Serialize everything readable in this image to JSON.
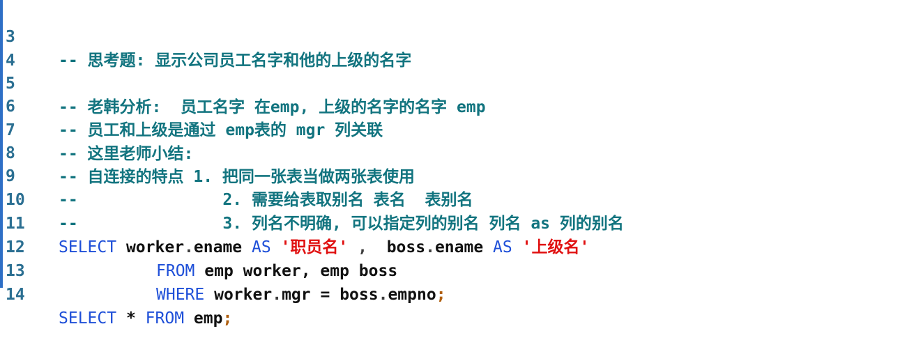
{
  "editor": {
    "lines": [
      {
        "n": "3",
        "text": "-- 思考题: 显示公司员工名字和他的上级的名字"
      },
      {
        "n": "4",
        "text": ""
      },
      {
        "n": "5",
        "text": "-- 老韩分析:  员工名字 在emp, 上级的名字的名字 emp"
      },
      {
        "n": "6",
        "text": "-- 员工和上级是通过 emp表的 mgr 列关联"
      },
      {
        "n": "7",
        "text": "-- 这里老师小结:"
      },
      {
        "n": "8",
        "text": "-- 自连接的特点 1. 把同一张表当做两张表使用"
      },
      {
        "n": "9",
        "text": "--               2. 需要给表取别名 表名  表别名"
      },
      {
        "n": "10",
        "text": "--               3. 列名不明确, 可以指定列的别名 列名 as 列的别名"
      },
      {
        "n": "11"
      },
      {
        "n": "12"
      },
      {
        "n": "13"
      },
      {
        "n": "14"
      }
    ],
    "sql": {
      "l11": {
        "select": "SELECT",
        "a": "worker",
        "dot1": ".",
        "b": "ename",
        "as1": "AS",
        "s1": "'职员名'",
        "comma": " ,",
        "c": "boss",
        "dot2": ".",
        "d": "ename",
        "as2": "AS",
        "s2": "'上级名'"
      },
      "l12": {
        "from": "FROM",
        "rest": "emp worker, emp boss"
      },
      "l13": {
        "where": "WHERE",
        "a": "worker",
        "dot1": ".",
        "b": "mgr",
        "eq": "=",
        "c": "boss",
        "dot2": ".",
        "d": "empno",
        "semi": ";"
      },
      "l14": {
        "select": "SELECT",
        "star": "*",
        "from": "FROM",
        "table": "emp",
        "semi": ";"
      }
    }
  }
}
